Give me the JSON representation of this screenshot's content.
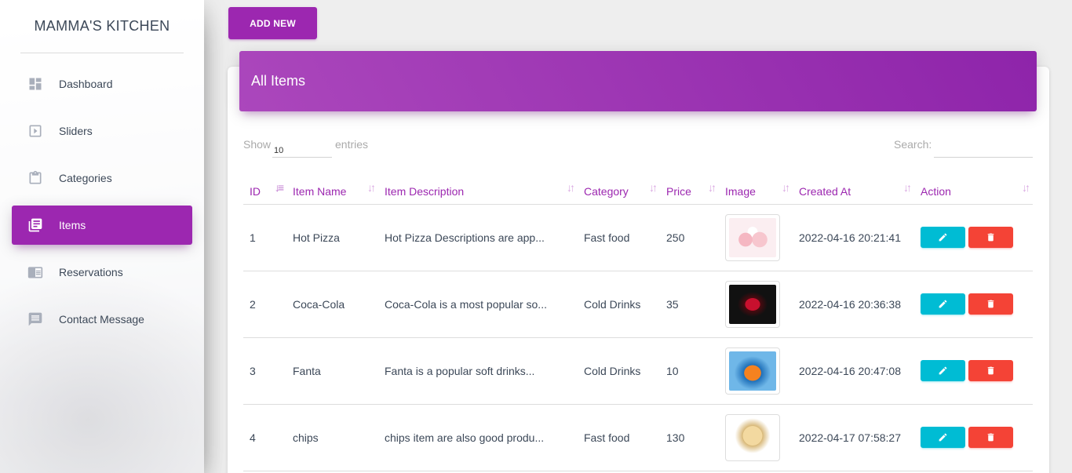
{
  "sidebar": {
    "logo": "MAMMA'S KITCHEN",
    "items": [
      {
        "label": "Dashboard",
        "icon": "dashboard-icon",
        "active": false
      },
      {
        "label": "Sliders",
        "icon": "slideshow-icon",
        "active": false
      },
      {
        "label": "Categories",
        "icon": "clipboard-icon",
        "active": false
      },
      {
        "label": "Items",
        "icon": "library-books-icon",
        "active": true
      },
      {
        "label": "Reservations",
        "icon": "chrome-reader-icon",
        "active": false
      },
      {
        "label": "Contact Message",
        "icon": "message-icon",
        "active": false
      }
    ]
  },
  "toolbar": {
    "add_new_label": "ADD NEW"
  },
  "card": {
    "title": "All Items"
  },
  "controls": {
    "show_label": "Show",
    "show_value": "10",
    "entries_label": "entries",
    "search_label": "Search:"
  },
  "table": {
    "columns": [
      "ID",
      "Item Name",
      "Item Description",
      "Category",
      "Price",
      "Image",
      "Created At",
      "Action"
    ],
    "rows": [
      {
        "id": "1",
        "name": "Hot Pizza",
        "description": "Hot Pizza Descriptions are app...",
        "category": "Fast food",
        "price": "250",
        "image": "pizza",
        "created_at": "2022-04-16 20:21:41"
      },
      {
        "id": "2",
        "name": "Coca-Cola",
        "description": "Coca-Cola is a most popular so...",
        "category": "Cold Drinks",
        "price": "35",
        "image": "coke",
        "created_at": "2022-04-16 20:36:38"
      },
      {
        "id": "3",
        "name": "Fanta",
        "description": "Fanta is a popular soft drinks...",
        "category": "Cold Drinks",
        "price": "10",
        "image": "fanta",
        "created_at": "2022-04-16 20:47:08"
      },
      {
        "id": "4",
        "name": "chips",
        "description": "chips item are also good produ...",
        "category": "Fast food",
        "price": "130",
        "image": "chips",
        "created_at": "2022-04-17 07:58:27"
      }
    ]
  },
  "colors": {
    "primary": "#9c27b0",
    "edit": "#00bcd4",
    "delete": "#f44336"
  }
}
